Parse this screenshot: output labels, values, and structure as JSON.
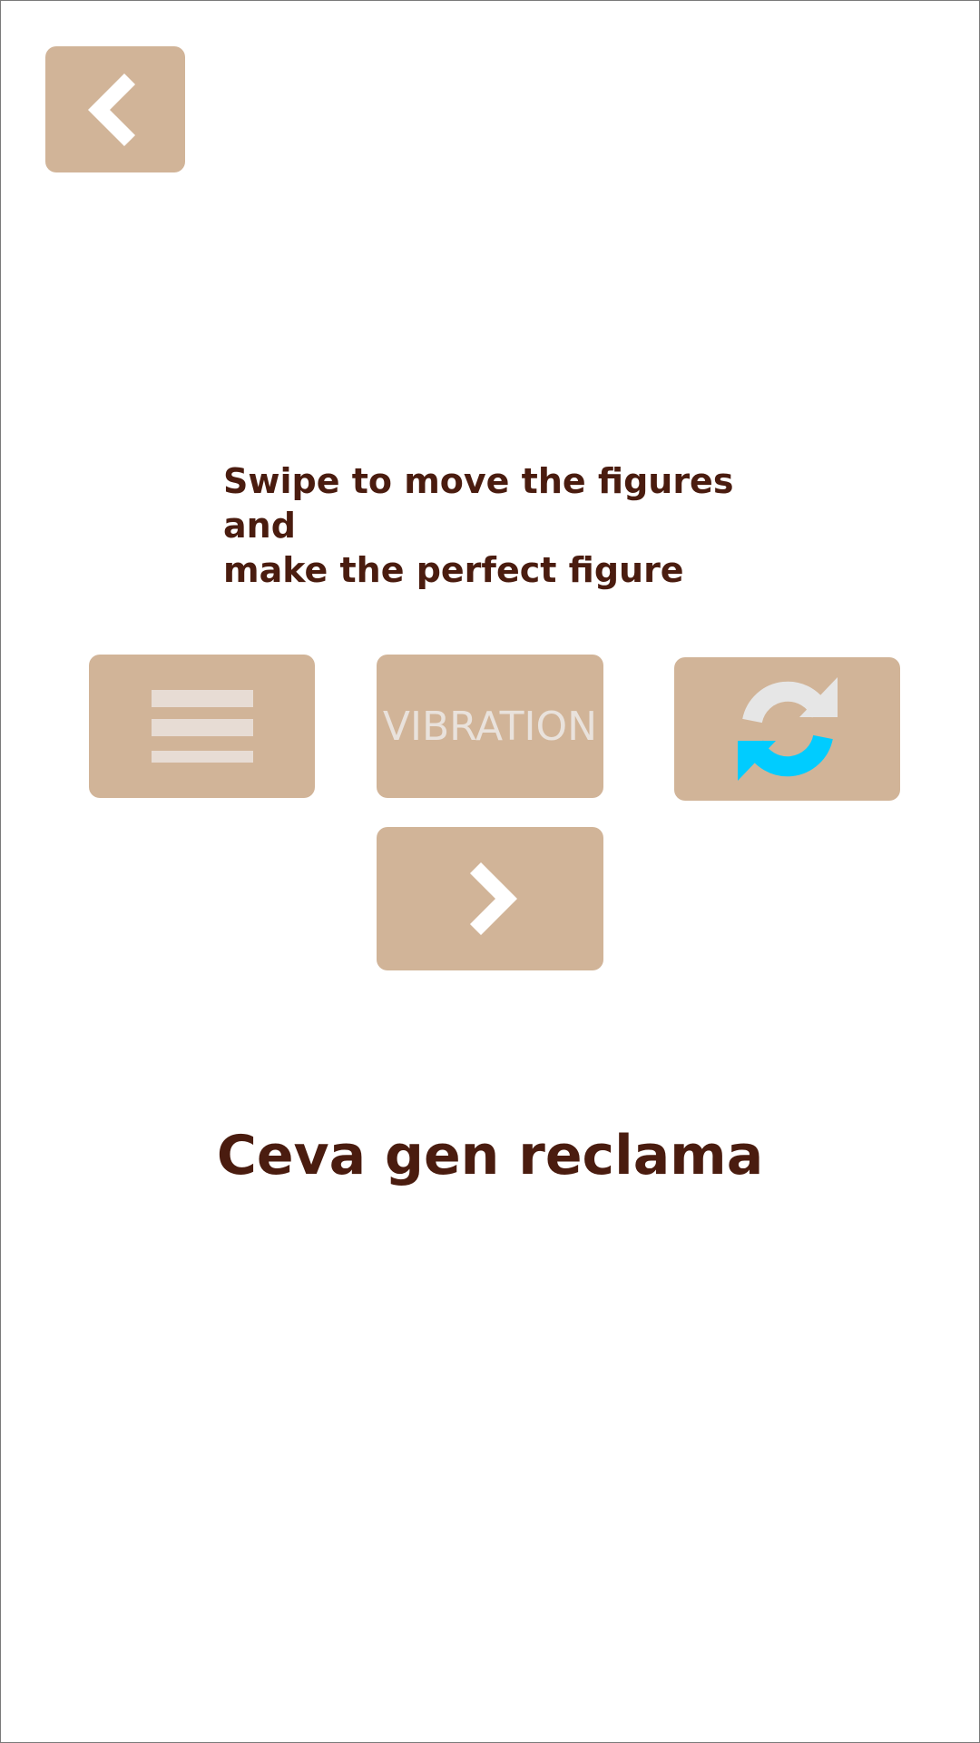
{
  "instruction": {
    "line1": "Swipe to move the figures and",
    "line2": "make the perfect figure"
  },
  "buttons": {
    "back": {
      "icon": "chevron-left-icon"
    },
    "menu": {
      "icon": "hamburger-menu-icon"
    },
    "vibration": {
      "label": "VIBRATION"
    },
    "restart": {
      "icon": "refresh-icon"
    },
    "next": {
      "icon": "chevron-right-icon"
    }
  },
  "ad": {
    "text": "Ceva gen reclama"
  },
  "colors": {
    "background": "#ffffff",
    "tile": "#d1b498",
    "text_dark": "#4a1c0f",
    "icon_light": "#ffffff",
    "refresh_gray": "#e6e6e6",
    "refresh_blue": "#00ccff"
  }
}
